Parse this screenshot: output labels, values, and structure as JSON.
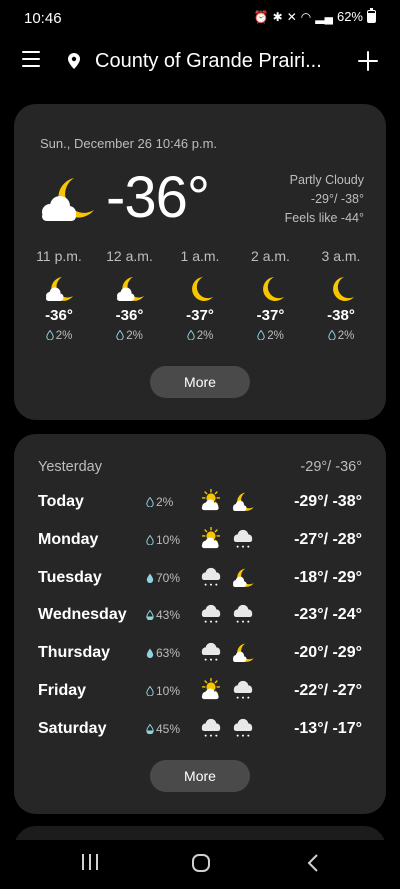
{
  "status": {
    "time": "10:46",
    "battery": "62%"
  },
  "header": {
    "location": "County of Grande Prairi..."
  },
  "current": {
    "datetime": "Sun., December 26 10:46 p.m.",
    "temp": "-36°",
    "condition": "Partly Cloudy",
    "high_low": "-29°/ -38°",
    "feels_like": "Feels like -44°",
    "icon": "partly-cloudy-night-icon"
  },
  "hourly": [
    {
      "time": "11 p.m.",
      "temp": "-36°",
      "precip": "2%",
      "icon": "partly-cloudy-night-icon"
    },
    {
      "time": "12 a.m.",
      "temp": "-36°",
      "precip": "2%",
      "icon": "partly-cloudy-night-icon"
    },
    {
      "time": "1 a.m.",
      "temp": "-37°",
      "precip": "2%",
      "icon": "moon-icon"
    },
    {
      "time": "2 a.m.",
      "temp": "-37°",
      "precip": "2%",
      "icon": "moon-icon"
    },
    {
      "time": "3 a.m.",
      "temp": "-38°",
      "precip": "2%",
      "icon": "moon-icon"
    }
  ],
  "more_label": "More",
  "yesterday": {
    "label": "Yesterday",
    "range": "-29°/ -36°"
  },
  "daily": [
    {
      "day": "Today",
      "precip": "2%",
      "icons": [
        "partly-sunny-icon",
        "partly-cloudy-night-icon"
      ],
      "range": "-29°/ -38°"
    },
    {
      "day": "Monday",
      "precip": "10%",
      "icons": [
        "partly-sunny-icon",
        "snow-cloud-icon"
      ],
      "range": "-27°/ -28°"
    },
    {
      "day": "Tuesday",
      "precip": "70%",
      "icons": [
        "snow-cloud-icon",
        "partly-cloudy-night-icon"
      ],
      "range": "-18°/ -29°"
    },
    {
      "day": "Wednesday",
      "precip": "43%",
      "icons": [
        "snow-cloud-icon",
        "snow-cloud-icon"
      ],
      "range": "-23°/ -24°"
    },
    {
      "day": "Thursday",
      "precip": "63%",
      "icons": [
        "snow-cloud-icon",
        "partly-cloudy-night-icon"
      ],
      "range": "-20°/ -29°"
    },
    {
      "day": "Friday",
      "precip": "10%",
      "icons": [
        "partly-sunny-icon",
        "snow-cloud-icon"
      ],
      "range": "-22°/ -27°"
    },
    {
      "day": "Saturday",
      "precip": "45%",
      "icons": [
        "snow-cloud-icon",
        "snow-cloud-icon"
      ],
      "range": "-13°/ -17°"
    }
  ],
  "colors": {
    "moon": "#f7c600",
    "sun": "#f7c600",
    "card": "#262626",
    "drop": "#8fd3e0"
  }
}
